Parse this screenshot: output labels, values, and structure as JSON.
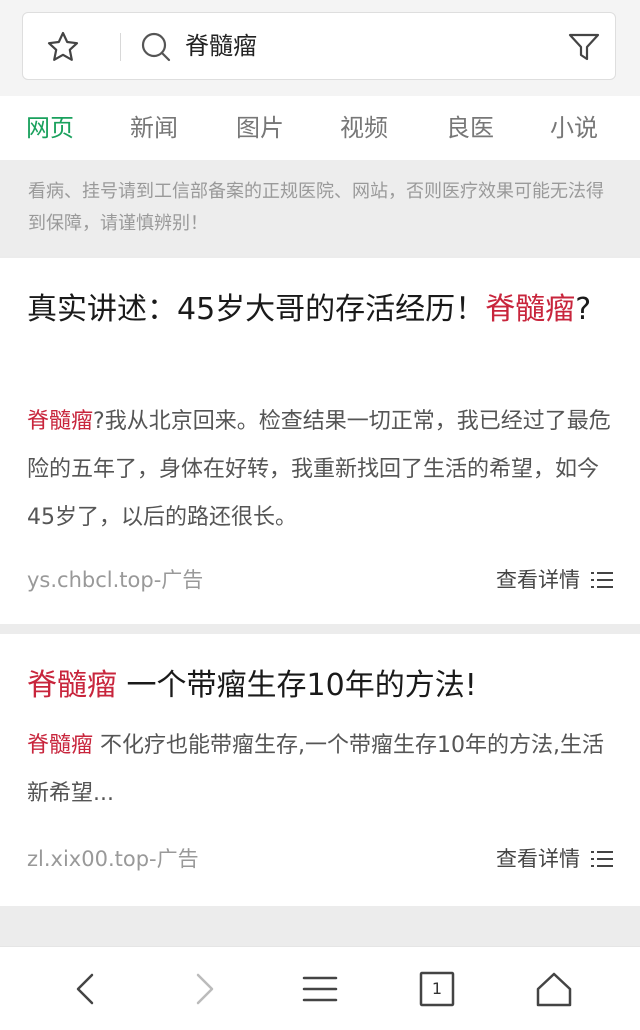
{
  "search": {
    "query": "脊髓瘤",
    "icons": [
      "star-icon",
      "search-icon",
      "filter-icon"
    ]
  },
  "tabs": [
    {
      "label": "网页",
      "active": true
    },
    {
      "label": "新闻",
      "active": false
    },
    {
      "label": "图片",
      "active": false
    },
    {
      "label": "视频",
      "active": false
    },
    {
      "label": "良医",
      "active": false
    },
    {
      "label": "小说",
      "active": false
    }
  ],
  "notice": {
    "text": "看病、挂号请到工信部备案的正规医院、网站，否则医疗效果可能无法得到保障，请谨慎辨别！"
  },
  "results": [
    {
      "title_prefix": "真实讲述：45岁大哥的存活经历！",
      "title_keyword": "脊髓瘤",
      "title_suffix": "?",
      "desc_keyword": "脊髓瘤",
      "desc_rest": "?我从北京回来。检查结果一切正常，我已经过了最危险的五年了，身体在好转，我重新找回了生活的希望，如今45岁了，以后的路还很长。",
      "source": "ys.chbcl.top-广告",
      "detail_label": "查看详情"
    },
    {
      "title_keyword": "脊髓瘤",
      "title_rest": " 一个带瘤生存10年的方法!",
      "desc_keyword": "脊髓瘤",
      "desc_rest": " 不化疗也能带瘤生存,一个带瘤生存10年的方法,生活新希望...",
      "source": "zl.xix00.top-广告",
      "detail_label": "查看详情"
    }
  ],
  "bottom_nav": {
    "tab_count": "1",
    "icons": [
      "back-icon",
      "forward-icon",
      "menu-icon",
      "tabs-icon",
      "home-icon"
    ]
  },
  "colors": {
    "accent": "#1aa15d",
    "keyword": "#c8253c",
    "muted": "#999999"
  }
}
